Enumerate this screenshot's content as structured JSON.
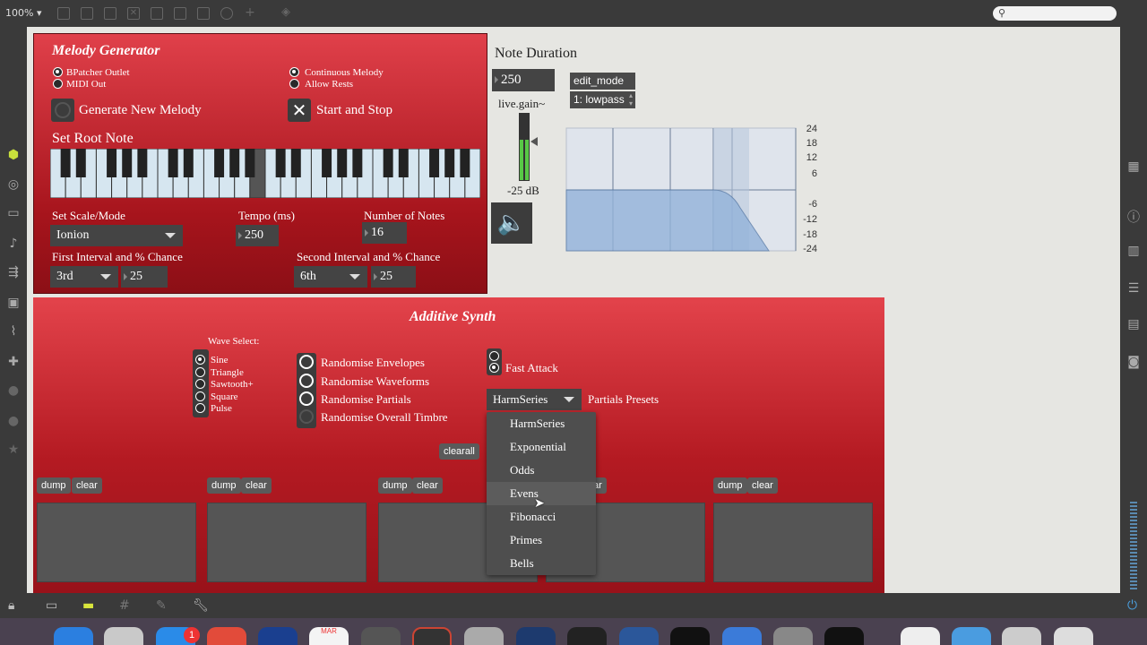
{
  "toolbar": {
    "zoom": "100%",
    "search_placeholder": ""
  },
  "melody": {
    "title": "Melody Generator",
    "out_opts": [
      "BPatcher Outlet",
      "MIDI Out"
    ],
    "mode_opts": [
      "Continuous Melody",
      "Allow Rests"
    ],
    "generate": "Generate New Melody",
    "startstop": "Start and Stop",
    "root": "Set Root Note",
    "scale_label": "Set Scale/Mode",
    "scale_value": "Ionion",
    "tempo_label": "Tempo (ms)",
    "tempo_value": "250",
    "notes_label": "Number of Notes",
    "notes_value": "16",
    "first_label": "First Interval and % Chance",
    "first_interval": "3rd",
    "first_chance": "25",
    "second_label": "Second Interval and % Chance",
    "second_interval": "6th",
    "second_chance": "25"
  },
  "note": {
    "title": "Note Duration",
    "value": "250",
    "gain_label": "live.gain~",
    "gain_db": "-25 dB",
    "edit_mode": "edit_mode",
    "filter": "1: lowpass",
    "scale_ticks": [
      "24",
      "18",
      "12",
      "6",
      "-6",
      "-12",
      "-18",
      "-24"
    ]
  },
  "synth": {
    "title": "Additive Synth",
    "wave_label": "Wave Select:",
    "waves": [
      "Sine",
      "Triangle",
      "Sawtooth+",
      "Square",
      "Pulse"
    ],
    "randomise": [
      "Randomise Envelopes",
      "Randomise Waveforms",
      "Randomise Partials",
      "Randomise Overall Timbre"
    ],
    "fast_attack": "Fast Attack",
    "preset_value": "HarmSeries",
    "presets_label": "Partials Presets",
    "clearall": "clearall",
    "dump": "dump",
    "clear": "clear",
    "partial_clear_partial": "ar"
  },
  "menu": {
    "items": [
      "HarmSeries",
      "Exponential",
      "Odds",
      "Evens",
      "Fibonacci",
      "Primes",
      "Bells"
    ],
    "hover": "Evens"
  },
  "dock": {
    "badge": "1",
    "cal_month": "MAR"
  }
}
